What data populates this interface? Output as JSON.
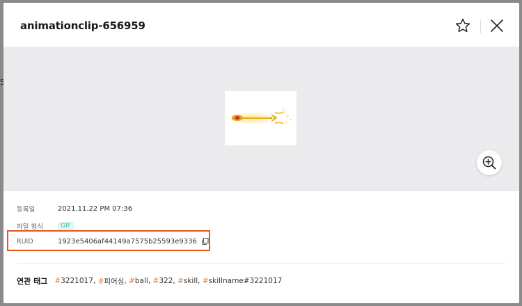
{
  "backdrop": {
    "fragment": "5"
  },
  "modal": {
    "title": "animationclip-656959",
    "favorite_icon": "star-outline-icon",
    "close_icon": "close-icon",
    "zoom_icon": "zoom-in-icon"
  },
  "info": {
    "registered_label": "등록일",
    "registered_value": "2021.11.22 PM 07:36",
    "filetype_label": "파일 형식",
    "filetype_value": "GIF",
    "ruid_label": "RUID",
    "ruid_value": "1923e5406af44149a7575b25593e9336",
    "copy_icon": "copy-icon"
  },
  "tags": {
    "label": "연관 태그",
    "items": [
      {
        "hash": "#",
        "text": "3221017",
        "sep": ", "
      },
      {
        "hash": "#",
        "text": "피어싱",
        "sep": ", "
      },
      {
        "hash": "#",
        "text": "ball",
        "sep": ", "
      },
      {
        "hash": "#",
        "text": "322",
        "sep": ", "
      },
      {
        "hash": "#",
        "text": "skill",
        "sep": ", "
      },
      {
        "hash": "#",
        "text": "skillname#3221017",
        "sep": ""
      }
    ]
  },
  "colors": {
    "accent_tag_hash": "#f07a3a",
    "highlight_border": "#e8541c",
    "gif_badge_text": "#39b9a1",
    "preview_bg": "#ebebee"
  }
}
